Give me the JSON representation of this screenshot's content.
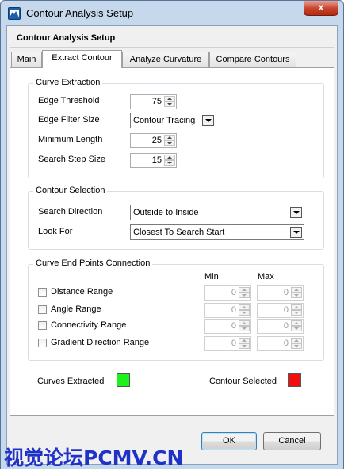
{
  "window": {
    "title": "Contour Analysis Setup",
    "close_glyph": "x"
  },
  "header": {
    "title": "Contour Analysis Setup"
  },
  "tabs": [
    {
      "label": "Main",
      "active": false
    },
    {
      "label": "Extract Contour",
      "active": true
    },
    {
      "label": "Analyze Curvature",
      "active": false
    },
    {
      "label": "Compare Contours",
      "active": false
    }
  ],
  "curve_extraction": {
    "title": "Curve Extraction",
    "edge_threshold": {
      "label": "Edge Threshold",
      "value": "75"
    },
    "edge_filter_size": {
      "label": "Edge Filter Size",
      "value": "Contour Tracing"
    },
    "minimum_length": {
      "label": "Minimum Length",
      "value": "25"
    },
    "search_step_size": {
      "label": "Search Step Size",
      "value": "15"
    }
  },
  "contour_selection": {
    "title": "Contour Selection",
    "search_direction": {
      "label": "Search Direction",
      "value": "Outside to Inside"
    },
    "look_for": {
      "label": "Look For",
      "value": "Closest To Search Start"
    }
  },
  "end_points": {
    "title": "Curve End Points Connection",
    "min_header": "Min",
    "max_header": "Max",
    "rows": [
      {
        "label": "Distance Range",
        "checked": false,
        "min": "0",
        "max": "0"
      },
      {
        "label": "Angle Range",
        "checked": false,
        "min": "0",
        "max": "0"
      },
      {
        "label": "Connectivity Range",
        "checked": false,
        "min": "0",
        "max": "0"
      },
      {
        "label": "Gradient Direction Range",
        "checked": false,
        "min": "0",
        "max": "0"
      }
    ]
  },
  "indicators": {
    "curves_extracted": {
      "label": "Curves Extracted",
      "color": "#1ef21e"
    },
    "contour_selected": {
      "label": "Contour Selected",
      "color": "#f01010"
    }
  },
  "buttons": {
    "ok": "OK",
    "cancel": "Cancel"
  },
  "watermark": "视觉论坛PCMV.CN"
}
